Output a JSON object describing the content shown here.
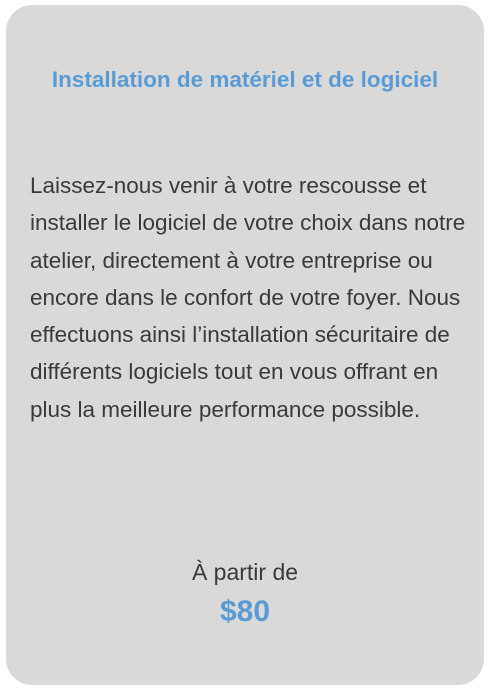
{
  "card": {
    "title": "Installation de matériel et de logiciel",
    "description": "Laissez-nous venir à votre rescousse et installer le logiciel de votre choix dans notre atelier, directement à votre entreprise ou encore dans le confort de votre foyer. Nous effectuons ainsi l’installation sécuritaire de différents logiciels tout en vous offrant en plus la meilleure performance possible.",
    "price_label": "À partir de",
    "price_value": "$80"
  },
  "colors": {
    "card_background": "#d9d9d9",
    "accent": "#5b9bd5",
    "text": "#3a3a3a"
  }
}
